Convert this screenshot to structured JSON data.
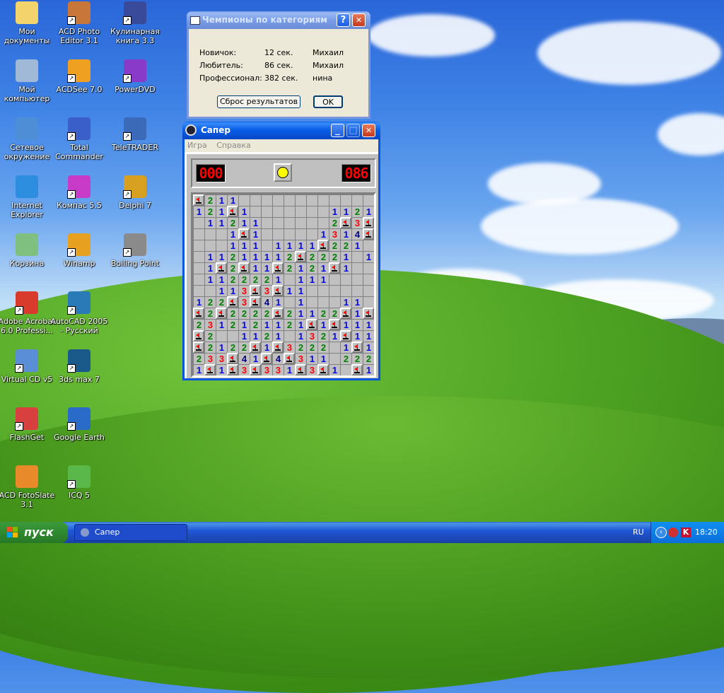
{
  "desktop": {
    "icons": [
      {
        "label": "Мои документы",
        "icon": "folder-icon",
        "color": "#f3d36b"
      },
      {
        "label": "Мой компьютер",
        "icon": "computer-icon",
        "color": "#9fb9d6"
      },
      {
        "label": "Сетевое окружение",
        "icon": "network-icon",
        "color": "#4d8ed6"
      },
      {
        "label": "Internet Explorer",
        "icon": "ie-icon",
        "color": "#2d8ee0"
      },
      {
        "label": "Корзина",
        "icon": "recycle-bin-icon",
        "color": "#7fbf7f"
      },
      {
        "label": "Adobe Acrobat 6.0 Professi...",
        "icon": "acrobat-icon",
        "color": "#d83b2b"
      },
      {
        "label": "Virtual CD v5",
        "icon": "cd-icon",
        "color": "#5a8fd8"
      },
      {
        "label": "FlashGet",
        "icon": "flashget-icon",
        "color": "#d84040"
      },
      {
        "label": "ACD FotoSlate 3.1",
        "icon": "fotoslate-icon",
        "color": "#e88a2a"
      },
      {
        "label": "ACD Photo Editor 3.1",
        "icon": "photo-editor-icon",
        "color": "#c8763a"
      },
      {
        "label": "ACDSee 7.0",
        "icon": "acdsee-icon",
        "color": "#f0a020"
      },
      {
        "label": "Total Commander",
        "icon": "total-commander-icon",
        "color": "#3a5fc8"
      },
      {
        "label": "Компас 5.5",
        "icon": "kompas-icon",
        "color": "#c83ac8"
      },
      {
        "label": "Winamp",
        "icon": "winamp-icon",
        "color": "#e8a020"
      },
      {
        "label": "AutoCAD 2005 - Русский",
        "icon": "autocad-icon",
        "color": "#2a7ab8"
      },
      {
        "label": "3ds max 7",
        "icon": "3dsmax-icon",
        "color": "#1a5a8a"
      },
      {
        "label": "Google Earth",
        "icon": "google-earth-icon",
        "color": "#2a6ac8"
      },
      {
        "label": "ICQ 5",
        "icon": "icq-icon",
        "color": "#5ab84a"
      },
      {
        "label": "Кулинарная книга 3.3",
        "icon": "cookbook-icon",
        "color": "#3a4a9a"
      },
      {
        "label": "PowerDVD",
        "icon": "powerdvd-icon",
        "color": "#8a3ac8"
      },
      {
        "label": "TeleTRADER",
        "icon": "teletrader-icon",
        "color": "#3a6ab8"
      },
      {
        "label": "Delphi 7",
        "icon": "delphi-icon",
        "color": "#d8a020"
      },
      {
        "label": "Boiling Point",
        "icon": "boiling-point-icon",
        "color": "#8a8a8a"
      }
    ]
  },
  "champions_dialog": {
    "title": "Чемпионы по категориям",
    "rows": [
      {
        "category": "Новичок:",
        "time": "12 сек.",
        "name": "Михаил"
      },
      {
        "category": "Любитель:",
        "time": "86 сек.",
        "name": "Михаил"
      },
      {
        "category": "Профессионал:",
        "time": "382 сек.",
        "name": "нина"
      }
    ],
    "reset_button": "Сброс результатов",
    "ok_button": "OK",
    "help_button": "?",
    "close_button": "✕"
  },
  "minesweeper": {
    "title": "Сапер",
    "menu": [
      "Игра",
      "Справка"
    ],
    "mines_counter": "000",
    "timer": "086",
    "grid": [
      "F211............",
      "121F1.......1121",
      ".11211......2F3F",
      "...1F1.....1314F2",
      "...111.1111F221",
      ".11211112F2221.1",
      ".1F2F11F2121F1.",
      ".1122221.111....",
      "..113F3F11......",
      "122F3F41.1...11",
      "F2F2222F21122F1F",
      "2312121121F1F111",
      "F2..1121.1321F11",
      "F2122F1F3222.1F1",
      "233F41F4F311.222",
      "1F1F3F331F3F1.F1"
    ]
  },
  "taskbar": {
    "start_label": "пуск",
    "task_label": "Сапер",
    "language": "RU",
    "clock": "18:20"
  }
}
